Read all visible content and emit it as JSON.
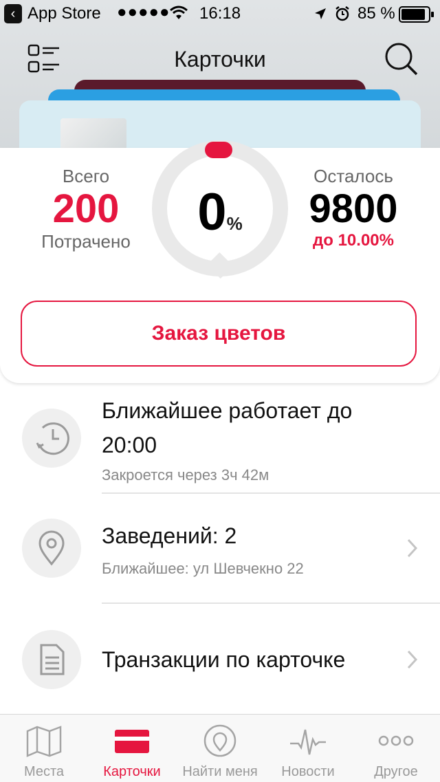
{
  "status_bar": {
    "back_label": "App Store",
    "signal": "●●●●●",
    "time": "16:18",
    "battery": "85 %"
  },
  "nav": {
    "title": "Карточки"
  },
  "summary": {
    "total_label": "Всего",
    "total_value": "200",
    "spent_label": "Потрачено",
    "progress_value": "0",
    "progress_unit": "%",
    "remaining_label": "Осталось",
    "remaining_value": "9800",
    "remaining_note": "до 10.00%"
  },
  "order_button_label": "Заказ цветов",
  "list": {
    "hours": {
      "title_line1": "Ближайшее работает до",
      "title_line2": "20:00",
      "subtitle": "Закроется через 3ч 42м"
    },
    "places": {
      "title": "Заведений: 2",
      "subtitle": "Ближайшее: ул Шевчекно 22"
    },
    "transactions": {
      "title": "Транзакции по карточке"
    }
  },
  "tabs": [
    {
      "label": "Места",
      "icon": "map-icon"
    },
    {
      "label": "Карточки",
      "icon": "card-icon"
    },
    {
      "label": "Найти меня",
      "icon": "location-pin-icon"
    },
    {
      "label": "Новости",
      "icon": "pulse-icon"
    },
    {
      "label": "Другое",
      "icon": "more-icon"
    }
  ],
  "colors": {
    "accent": "#e5163f",
    "tab_inactive": "#999999"
  }
}
